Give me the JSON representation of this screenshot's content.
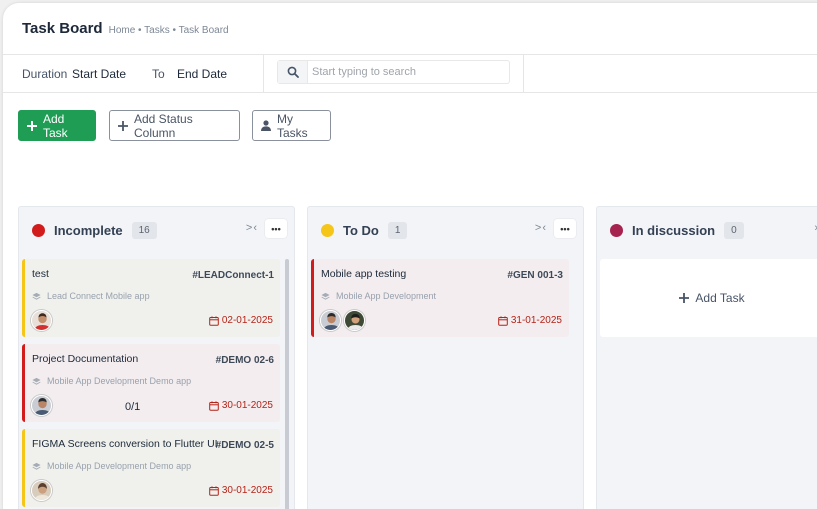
{
  "header": {
    "title": "Task Board",
    "breadcrumb": "Home • Tasks • Task Board"
  },
  "filters": {
    "duration_label": "Duration",
    "start_date": "Start Date",
    "to_label": "To",
    "end_date": "End Date",
    "search_placeholder": "Start typing to search"
  },
  "actions": {
    "add_task": "Add Task",
    "add_status_column": "Add Status Column",
    "my_tasks": "My Tasks"
  },
  "columns": [
    {
      "title": "Incomplete",
      "count": "16",
      "color": "#d21c1c",
      "collapse": ">‹",
      "more": "•••"
    },
    {
      "title": "To Do",
      "count": "1",
      "color": "#f5c518",
      "collapse": ">‹",
      "more": "•••"
    },
    {
      "title": "In discussion",
      "count": "0",
      "color": "#a5234e",
      "collapse": "›",
      "add_task": "Add Task"
    }
  ],
  "cards": {
    "incomplete": [
      {
        "name": "test",
        "code": "#LEADConnect-1",
        "project": "Lead Connect Mobile app",
        "subtasks": "",
        "due": "02-01-2025",
        "accent": "#f5c518"
      },
      {
        "name": "Project Documentation",
        "code": "#DEMO 02-6",
        "project": "Mobile App Development Demo app",
        "subtasks": "0/1",
        "due": "30-01-2025",
        "accent": "#d21c1c"
      },
      {
        "name": "FIGMA Screens conversion to Flutter UI",
        "code": "#DEMO 02-5",
        "project": "Mobile App Development Demo app",
        "subtasks": "",
        "due": "30-01-2025",
        "accent": "#f5c518"
      }
    ],
    "todo": [
      {
        "name": "Mobile app testing",
        "code": "#GEN 001-3",
        "project": "Mobile App Development",
        "subtasks": "",
        "due": "31-01-2025",
        "accent": "#d21c1c"
      }
    ]
  }
}
